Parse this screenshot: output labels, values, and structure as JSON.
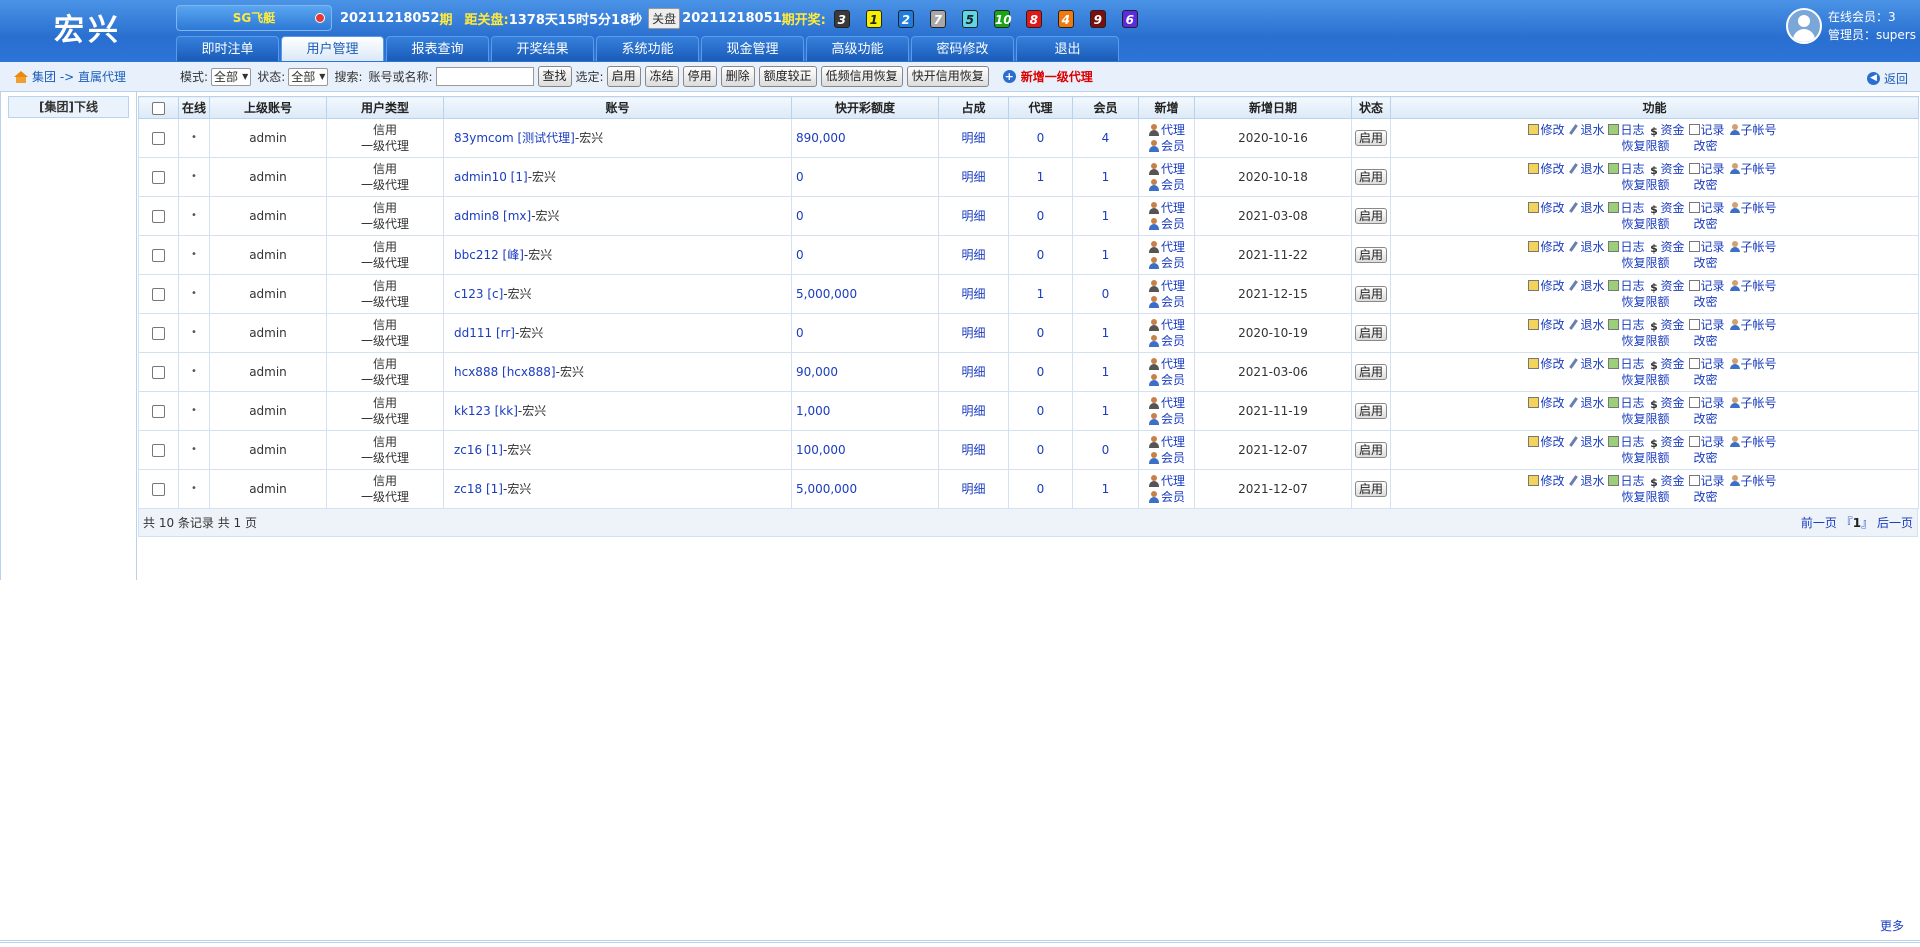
{
  "header": {
    "logo": "宏兴",
    "game": "SG飞艇",
    "period_current": "20211218052",
    "period_suffix": "期",
    "close_label": "距关盘:",
    "close_time": "1378天15时5分18秒",
    "close_btn": "关盘",
    "period_last": "20211218051",
    "last_label": "期开奖:",
    "balls": [
      {
        "n": "3",
        "bg": "#3a3a3a",
        "fg": "#fff"
      },
      {
        "n": "1",
        "bg": "#f5f000",
        "fg": "#222"
      },
      {
        "n": "2",
        "bg": "#1e7de0",
        "fg": "#fff"
      },
      {
        "n": "7",
        "bg": "#a8a8a8",
        "fg": "#fff"
      },
      {
        "n": "5",
        "bg": "#5fd6e8",
        "fg": "#222"
      },
      {
        "n": "10",
        "bg": "#17a617",
        "fg": "#fff"
      },
      {
        "n": "8",
        "bg": "#e01818",
        "fg": "#fff"
      },
      {
        "n": "4",
        "bg": "#f07a10",
        "fg": "#fff"
      },
      {
        "n": "9",
        "bg": "#7a0f0f",
        "fg": "#fff"
      },
      {
        "n": "6",
        "bg": "#5a2be0",
        "fg": "#fff"
      }
    ],
    "nav": [
      "即时注单",
      "用户管理",
      "报表查询",
      "开奖结果",
      "系统功能",
      "现金管理",
      "高级功能",
      "密码修改",
      "退出"
    ],
    "online": "在线会员：3",
    "admin": "管理员：supers"
  },
  "toolbar": {
    "crumb": "集团 -> 直属代理",
    "mode_label": "模式:",
    "mode_value": "全部",
    "status_label": "状态:",
    "status_value": "全部",
    "search_label": "搜索:",
    "account_label": "账号或名称:",
    "search_btn": "查找",
    "select_label": "选定:",
    "buttons": [
      "启用",
      "冻结",
      "停用",
      "删除",
      "额度较正",
      "低频信用恢复",
      "快开信用恢复"
    ],
    "add_agent": "新增一级代理",
    "back": "返回"
  },
  "sidebar": {
    "item": "[集团]下线"
  },
  "table": {
    "headers": [
      "在线",
      "上级账号",
      "用户类型",
      "账号",
      "快开彩额度",
      "占成",
      "代理",
      "会员",
      "新增",
      "新增日期",
      "状态",
      "功能"
    ],
    "rows": [
      {
        "online": "•",
        "parent": "admin",
        "type1": "信用",
        "type2": "一级代理",
        "account": "83ymcom [测试代理]",
        "suffix": "-宏兴",
        "quota": "890,000",
        "share": "明细",
        "agents": "0",
        "members": "4",
        "add_agent": "代理",
        "add_member": "会员",
        "date": "2020-10-16",
        "status": "启用"
      },
      {
        "online": "•",
        "parent": "admin",
        "type1": "信用",
        "type2": "一级代理",
        "account": "admin10 [1]",
        "suffix": "-宏兴",
        "quota": "0",
        "share": "明细",
        "agents": "1",
        "members": "1",
        "add_agent": "代理",
        "add_member": "会员",
        "date": "2020-10-18",
        "status": "启用"
      },
      {
        "online": "•",
        "parent": "admin",
        "type1": "信用",
        "type2": "一级代理",
        "account": "admin8 [mx]",
        "suffix": "-宏兴",
        "quota": "0",
        "share": "明细",
        "agents": "0",
        "members": "1",
        "add_agent": "代理",
        "add_member": "会员",
        "date": "2021-03-08",
        "status": "启用"
      },
      {
        "online": "•",
        "parent": "admin",
        "type1": "信用",
        "type2": "一级代理",
        "account": "bbc212 [峰]",
        "suffix": "-宏兴",
        "quota": "0",
        "share": "明细",
        "agents": "0",
        "members": "1",
        "add_agent": "代理",
        "add_member": "会员",
        "date": "2021-11-22",
        "status": "启用"
      },
      {
        "online": "•",
        "parent": "admin",
        "type1": "信用",
        "type2": "一级代理",
        "account": "c123 [c]",
        "suffix": "-宏兴",
        "quota": "5,000,000",
        "share": "明细",
        "agents": "1",
        "members": "0",
        "add_agent": "代理",
        "add_member": "会员",
        "date": "2021-12-15",
        "status": "启用"
      },
      {
        "online": "•",
        "parent": "admin",
        "type1": "信用",
        "type2": "一级代理",
        "account": "dd111 [rr]",
        "suffix": "-宏兴",
        "quota": "0",
        "share": "明细",
        "agents": "0",
        "members": "1",
        "add_agent": "代理",
        "add_member": "会员",
        "date": "2020-10-19",
        "status": "启用"
      },
      {
        "online": "•",
        "parent": "admin",
        "type1": "信用",
        "type2": "一级代理",
        "account": "hcx888 [hcx888]",
        "suffix": "-宏兴",
        "quota": "90,000",
        "share": "明细",
        "agents": "0",
        "members": "1",
        "add_agent": "代理",
        "add_member": "会员",
        "date": "2021-03-06",
        "status": "启用"
      },
      {
        "online": "•",
        "parent": "admin",
        "type1": "信用",
        "type2": "一级代理",
        "account": "kk123 [kk]",
        "suffix": "-宏兴",
        "quota": "1,000",
        "share": "明细",
        "agents": "0",
        "members": "1",
        "add_agent": "代理",
        "add_member": "会员",
        "date": "2021-11-19",
        "status": "启用"
      },
      {
        "online": "•",
        "parent": "admin",
        "type1": "信用",
        "type2": "一级代理",
        "account": "zc16 [1]",
        "suffix": "-宏兴",
        "quota": "100,000",
        "share": "明细",
        "agents": "0",
        "members": "0",
        "add_agent": "代理",
        "add_member": "会员",
        "date": "2021-12-07",
        "status": "启用"
      },
      {
        "online": "•",
        "parent": "admin",
        "type1": "信用",
        "type2": "一级代理",
        "account": "zc18 [1]",
        "suffix": "-宏兴",
        "quota": "5,000,000",
        "share": "明细",
        "agents": "0",
        "members": "1",
        "add_agent": "代理",
        "add_member": "会员",
        "date": "2021-12-07",
        "status": "启用"
      }
    ],
    "funcs": [
      "修改",
      "退水",
      "日志",
      "资金",
      "记录",
      "子帐号"
    ],
    "funcs2": [
      "恢复限额",
      "改密"
    ]
  },
  "footer": {
    "summary": "共 10 条记录 共 1 页",
    "prev": "前一页",
    "page_open": "『",
    "page": "1",
    "page_close": "』",
    "next": "后一页"
  },
  "more": "更多"
}
